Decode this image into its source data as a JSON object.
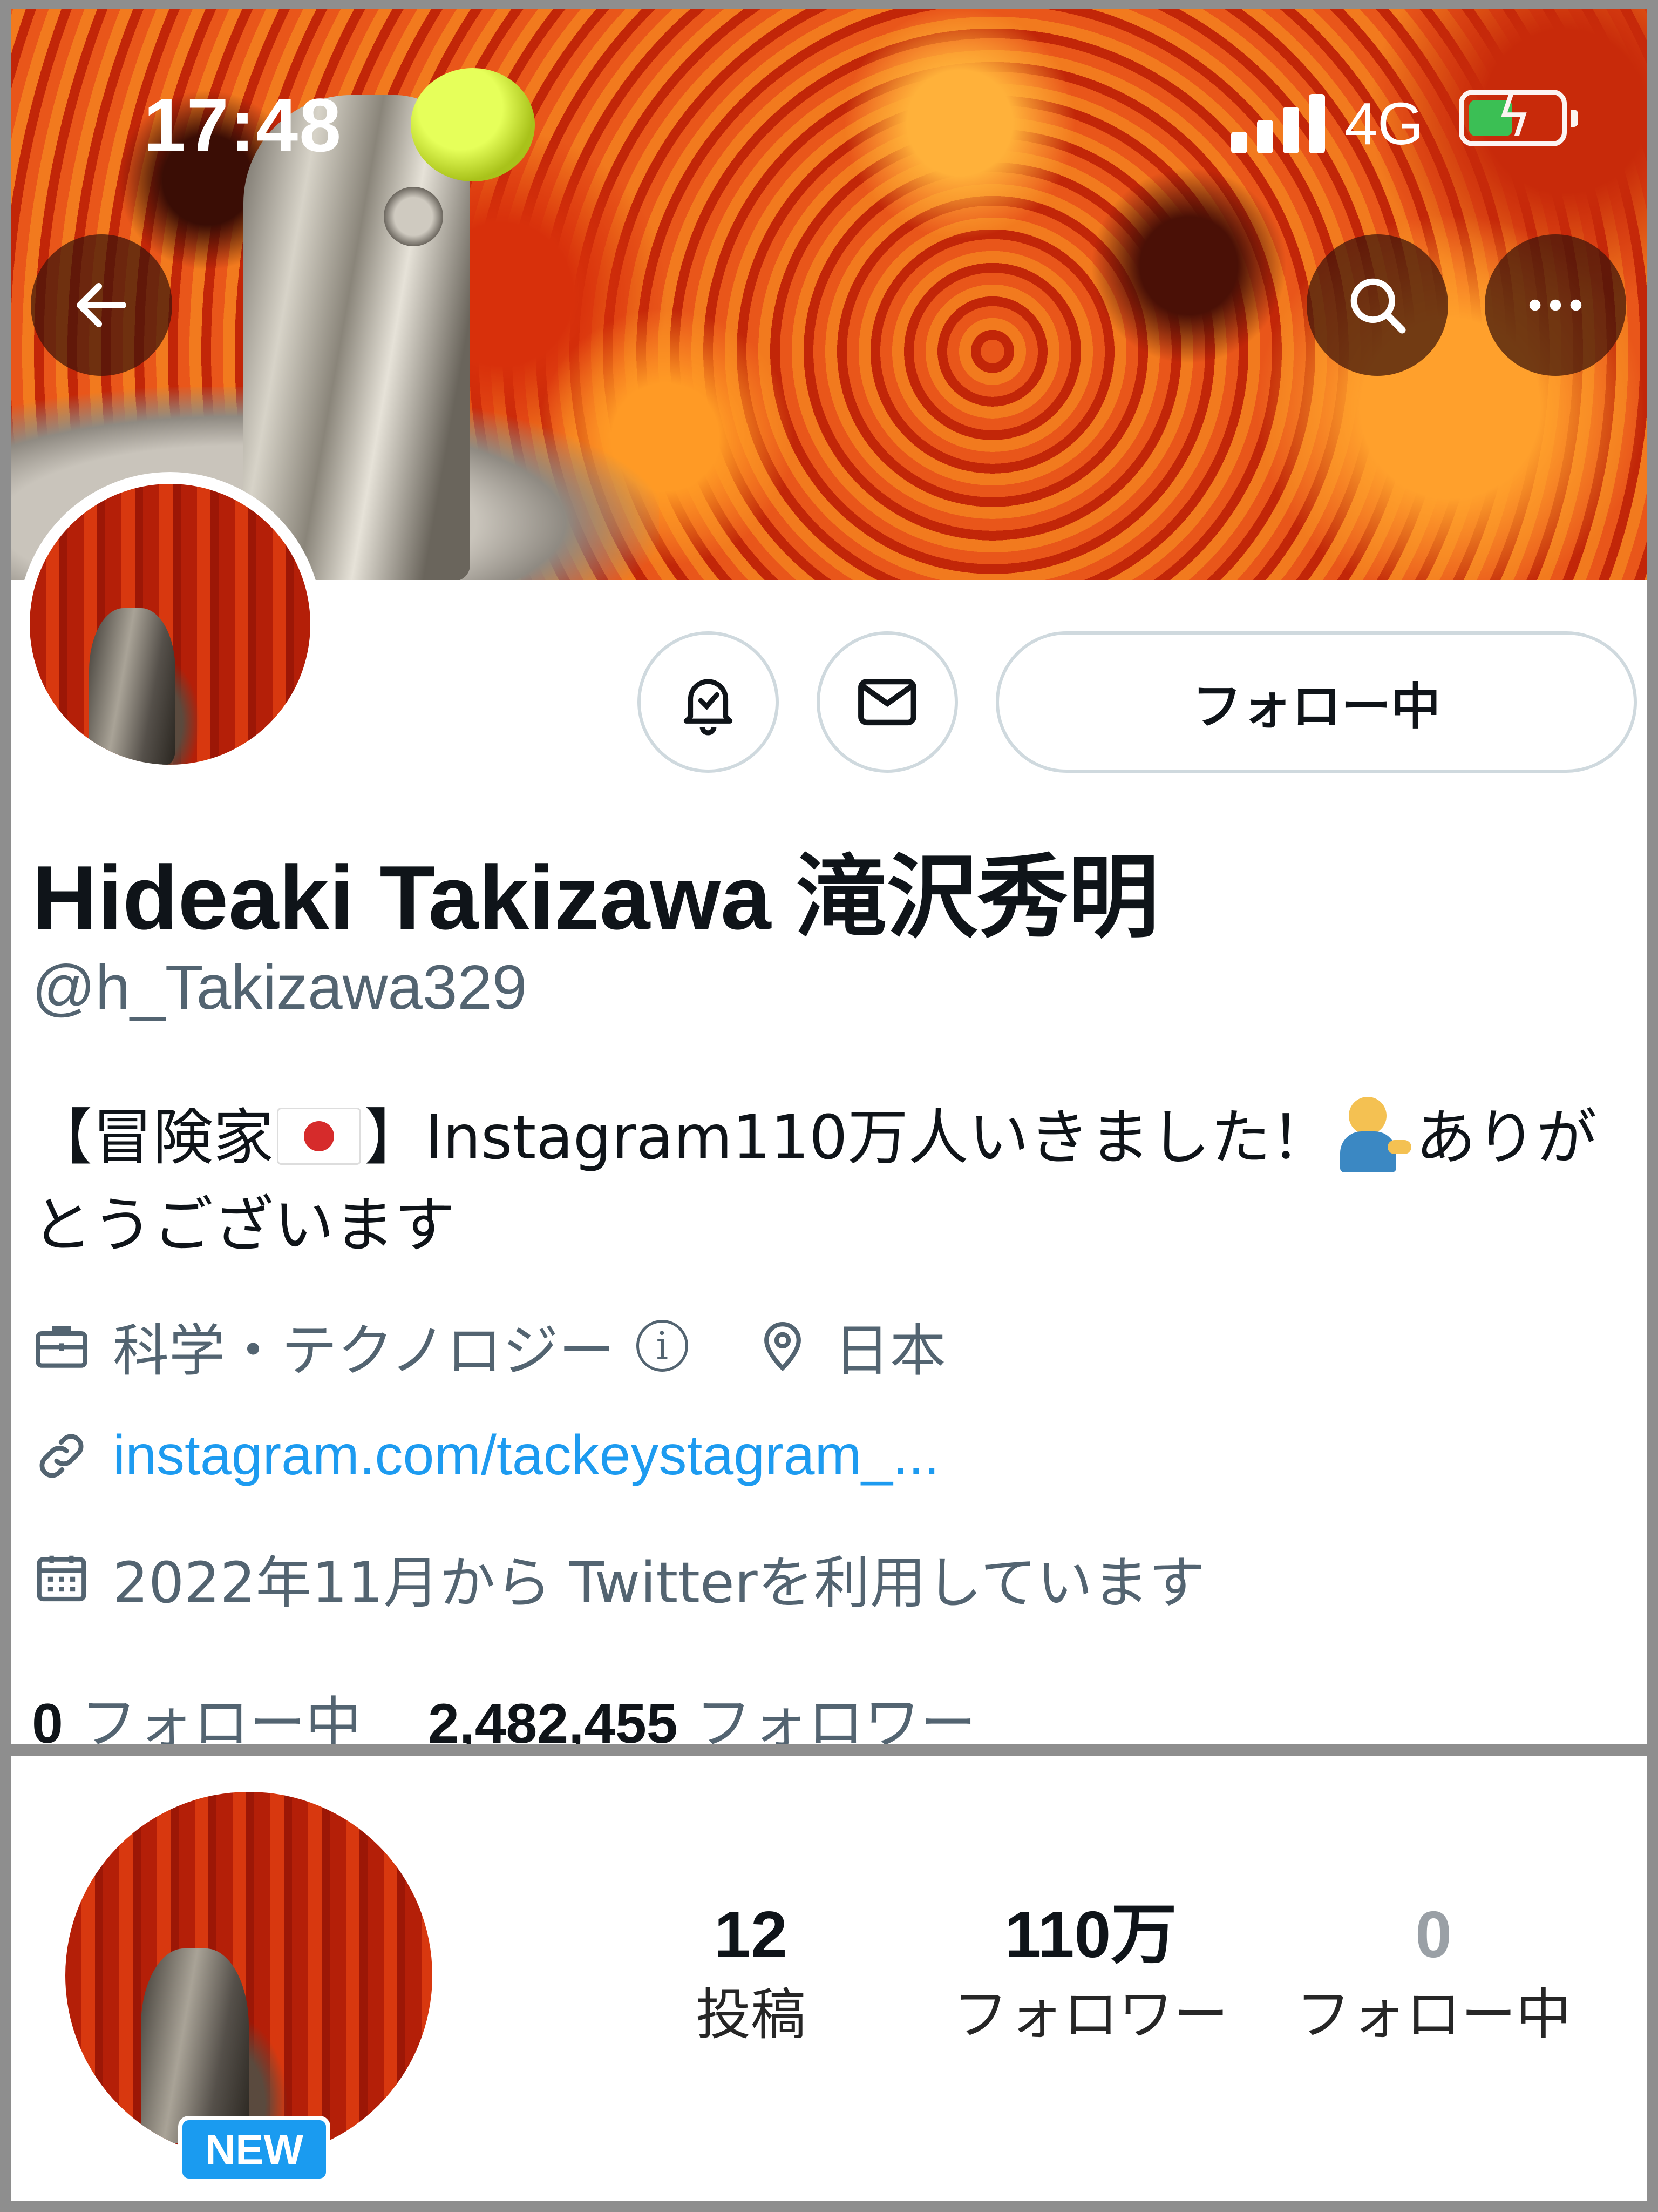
{
  "status_bar": {
    "time": "17:48",
    "network": "4G"
  },
  "profile": {
    "display_name": "Hideaki Takizawa 滝沢秀明",
    "handle": "@h_Takizawa329",
    "follow_button_label": "フォロー中",
    "bio": {
      "part1": "【冒険家",
      "part2": "】Instagram110万人いきました！",
      "part3": "ありがとうございます"
    },
    "category": "科学・テクノロジー",
    "location": "日本",
    "link": "instagram.com/tackeystagram_...",
    "joined": "2022年11月から Twitterを利用しています",
    "following_count": "0",
    "following_label": "フォロー中",
    "followers_count": "2,482,455",
    "followers_label": "フォロワー"
  },
  "instagram": {
    "badge": "NEW",
    "stats": [
      {
        "value": "12",
        "label": "投稿"
      },
      {
        "value": "110万",
        "label": "フォロワー"
      },
      {
        "value": "0",
        "label": "フォロー中"
      }
    ]
  },
  "icons": [
    "back-arrow-icon",
    "search-icon",
    "more-icon",
    "bell-check-icon",
    "mail-icon",
    "briefcase-icon",
    "info-icon",
    "location-pin-icon",
    "link-icon",
    "calendar-icon"
  ],
  "colors": {
    "link": "#1d9bf0",
    "secondary_text": "#536471",
    "badge": "#1a9bf0",
    "battery": "#34c759"
  }
}
